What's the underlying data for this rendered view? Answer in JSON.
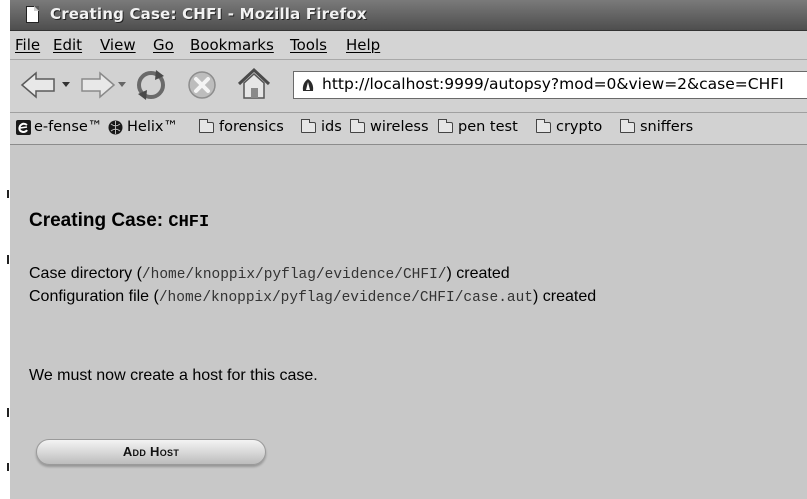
{
  "window": {
    "title": "Creating Case: CHFI - Mozilla Firefox"
  },
  "menubar": {
    "items": [
      "File",
      "Edit",
      "View",
      "Go",
      "Bookmarks",
      "Tools",
      "Help"
    ]
  },
  "navbar": {
    "url": "http://localhost:9999/autopsy?mod=0&view=2&case=CHFI"
  },
  "bookmarks": {
    "items": [
      {
        "label": "e-fense™",
        "icon": "e-fense-icon"
      },
      {
        "label": "Helix™",
        "icon": "helix-icon"
      },
      {
        "label": "forensics",
        "icon": "folder-icon"
      },
      {
        "label": "ids",
        "icon": "folder-icon"
      },
      {
        "label": "wireless",
        "icon": "folder-icon"
      },
      {
        "label": "pen test",
        "icon": "folder-icon"
      },
      {
        "label": "crypto",
        "icon": "folder-icon"
      },
      {
        "label": "sniffers",
        "icon": "folder-icon"
      }
    ]
  },
  "page": {
    "heading_prefix": "Creating Case: ",
    "case_name": "CHFI",
    "dir_prefix": "Case directory (",
    "dir_path": "/home/knoppix/pyflag/evidence/CHFI/",
    "dir_suffix": ") created",
    "config_prefix": "Configuration file (",
    "config_path": "/home/knoppix/pyflag/evidence/CHFI/case.aut",
    "config_suffix": ") created",
    "message": "We must now create a host for this case.",
    "add_host_label": "Add Host"
  }
}
